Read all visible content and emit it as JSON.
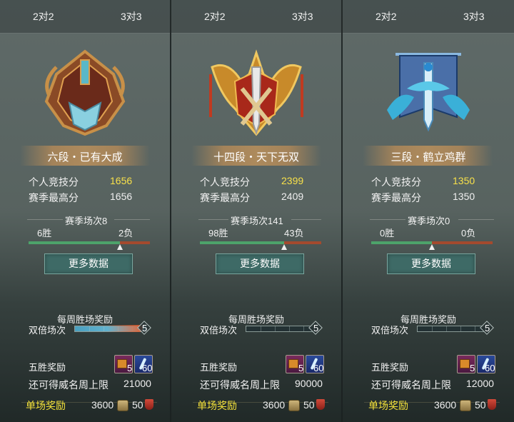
{
  "panels": [
    {
      "tabs": [
        "2对2",
        "3对3"
      ],
      "emblem_icon": "bronze-sword-shield-emblem-icon",
      "rank_name": "六段・已有大成",
      "personal_score_label": "个人竞技分",
      "personal_score": "1656",
      "season_high_label": "赛季最高分",
      "season_high": "1656",
      "season_matches": "赛季场次8",
      "wins": "6胜",
      "losses": "2负",
      "win_ratio": 0.75,
      "more_button": "更多数据",
      "weekly_title": "每周胜场奖励",
      "double_label": "双倍场次",
      "double_count": "5",
      "double_progress": 1.0,
      "five_win_label": "五胜奖励",
      "item1_count": "5",
      "item2_count": "60",
      "remaining_label": "还可得威名周上限",
      "remaining_value": "21000",
      "single_label": "单场奖励",
      "single_coin": "3600",
      "single_badge": "50"
    },
    {
      "tabs": [
        "2对2",
        "3对3"
      ],
      "emblem_icon": "golden-winged-sword-emblem-icon",
      "rank_name": "十四段・天下无双",
      "personal_score_label": "个人竞技分",
      "personal_score": "2399",
      "season_high_label": "赛季最高分",
      "season_high": "2409",
      "season_matches": "赛季场次141",
      "wins": "98胜",
      "losses": "43负",
      "win_ratio": 0.695,
      "more_button": "更多数据",
      "weekly_title": "每周胜场奖励",
      "double_label": "双倍场次",
      "double_count": "5",
      "double_progress": 0.0,
      "five_win_label": "五胜奖励",
      "item1_count": "5",
      "item2_count": "60",
      "remaining_label": "还可得威名周上限",
      "remaining_value": "90000",
      "single_label": "单场奖励",
      "single_coin": "3600",
      "single_badge": "50"
    },
    {
      "tabs": [
        "2对2",
        "3对3"
      ],
      "emblem_icon": "blue-crane-sword-banner-emblem-icon",
      "rank_name": "三段・鹤立鸡群",
      "personal_score_label": "个人竞技分",
      "personal_score": "1350",
      "season_high_label": "赛季最高分",
      "season_high": "1350",
      "season_matches": "赛季场次0",
      "wins": "0胜",
      "losses": "0负",
      "win_ratio": 0.5,
      "more_button": "更多数据",
      "weekly_title": "每周胜场奖励",
      "double_label": "双倍场次",
      "double_count": "5",
      "double_progress": 0.0,
      "five_win_label": "五胜奖励",
      "item1_count": "5",
      "item2_count": "60",
      "remaining_label": "还可得威名周上限",
      "remaining_value": "12000",
      "single_label": "单场奖励",
      "single_coin": "3600",
      "single_badge": "50"
    }
  ],
  "colors": {
    "score_highlight": "#f7e04a",
    "win_bar": "#4da36a",
    "loss_bar": "#a44a2e",
    "single_reward_label": "#f4e23a",
    "button_bg": "#3e6a66"
  }
}
